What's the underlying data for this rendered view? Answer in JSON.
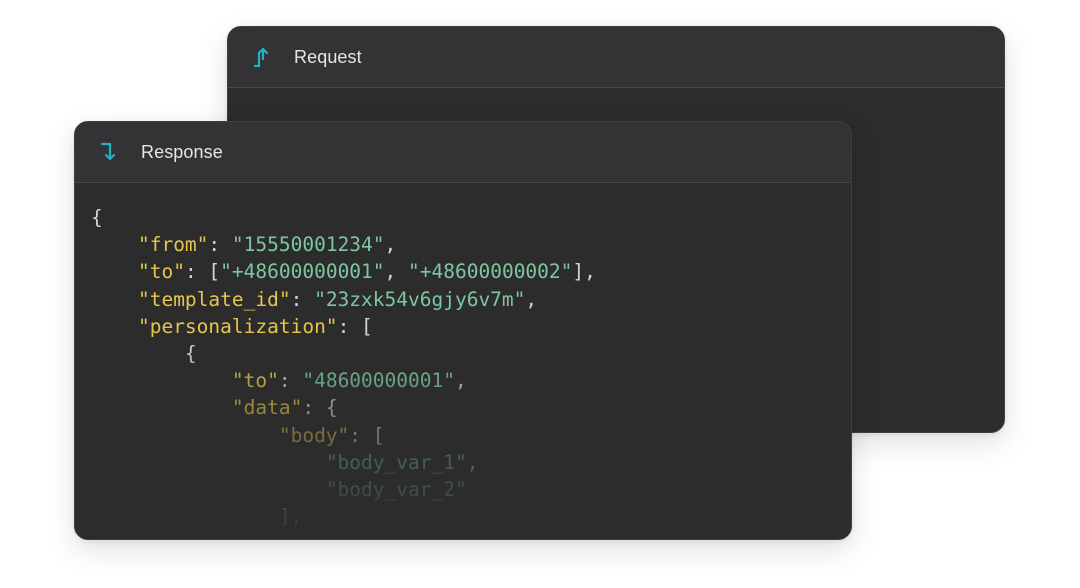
{
  "request_panel": {
    "title": "Request",
    "icon": "arrow-up-icon",
    "accent": "#22b3c4"
  },
  "response_panel": {
    "title": "Response",
    "icon": "arrow-down-icon",
    "accent": "#22b3c4",
    "code_lines": [
      [
        {
          "t": "p",
          "v": "{"
        }
      ],
      [
        {
          "t": "p",
          "v": "    "
        },
        {
          "t": "k",
          "v": "\"from\""
        },
        {
          "t": "p",
          "v": ": "
        },
        {
          "t": "s",
          "v": "\"15550001234\""
        },
        {
          "t": "p",
          "v": ","
        }
      ],
      [
        {
          "t": "p",
          "v": "    "
        },
        {
          "t": "k",
          "v": "\"to\""
        },
        {
          "t": "p",
          "v": ": ["
        },
        {
          "t": "s",
          "v": "\"+48600000001\""
        },
        {
          "t": "p",
          "v": ", "
        },
        {
          "t": "s",
          "v": "\"+48600000002\""
        },
        {
          "t": "p",
          "v": "],"
        }
      ],
      [
        {
          "t": "p",
          "v": "    "
        },
        {
          "t": "k",
          "v": "\"template_id\""
        },
        {
          "t": "p",
          "v": ": "
        },
        {
          "t": "s",
          "v": "\"23zxk54v6gjy6v7m\""
        },
        {
          "t": "p",
          "v": ","
        }
      ],
      [
        {
          "t": "p",
          "v": "    "
        },
        {
          "t": "k",
          "v": "\"personalization\""
        },
        {
          "t": "p",
          "v": ": ["
        }
      ],
      [
        {
          "t": "p",
          "v": "        {"
        }
      ],
      [
        {
          "t": "p",
          "v": "            "
        },
        {
          "t": "k",
          "v": "\"to\""
        },
        {
          "t": "p",
          "v": ": "
        },
        {
          "t": "s",
          "v": "\"48600000001\""
        },
        {
          "t": "p",
          "v": ","
        }
      ],
      [
        {
          "t": "p",
          "v": "            "
        },
        {
          "t": "k",
          "v": "\"data\""
        },
        {
          "t": "p",
          "v": ": {"
        }
      ],
      [
        {
          "t": "p",
          "v": "                "
        },
        {
          "t": "k",
          "v": "\"body\""
        },
        {
          "t": "p",
          "v": ": ["
        }
      ],
      [
        {
          "t": "p",
          "v": "                    "
        },
        {
          "t": "s",
          "v": "\"body_var_1\""
        },
        {
          "t": "p",
          "v": ","
        }
      ],
      [
        {
          "t": "p",
          "v": "                    "
        },
        {
          "t": "s",
          "v": "\"body_var_2\""
        }
      ],
      [
        {
          "t": "p",
          "v": "                ],"
        }
      ]
    ]
  }
}
